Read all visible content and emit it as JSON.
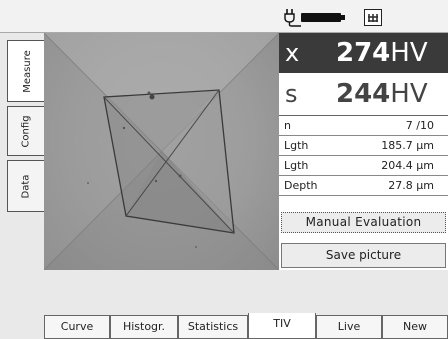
{
  "status_bar": {
    "power_icon": "plug-icon",
    "battery_icon": "battery-icon",
    "keypad_icon": "keypad-icon"
  },
  "side_tabs": [
    {
      "label": "Measure",
      "active": true
    },
    {
      "label": "Config",
      "active": false
    },
    {
      "label": "Data",
      "active": false
    }
  ],
  "results": {
    "x": {
      "label": "x",
      "value": "274",
      "unit": "HV"
    },
    "s": {
      "label": "s",
      "value": "244",
      "unit": "HV"
    },
    "rows": [
      {
        "key": "n",
        "value": "7 /10"
      },
      {
        "key": "Lgth",
        "value": "185.7 µm"
      },
      {
        "key": "Lgth",
        "value": "204.4 µm"
      },
      {
        "key": "Depth",
        "value": "27.8 µm"
      }
    ],
    "manual_evaluation_label": "Manual Evaluation",
    "save_picture_label": "Save picture"
  },
  "bottom_tabs": [
    {
      "label": "Curve",
      "active": false
    },
    {
      "label": "Histogr.",
      "active": false
    },
    {
      "label": "Statistics",
      "active": false
    },
    {
      "label": "TIV",
      "active": true
    },
    {
      "label": "Live",
      "active": false
    },
    {
      "label": "New",
      "active": false
    }
  ]
}
